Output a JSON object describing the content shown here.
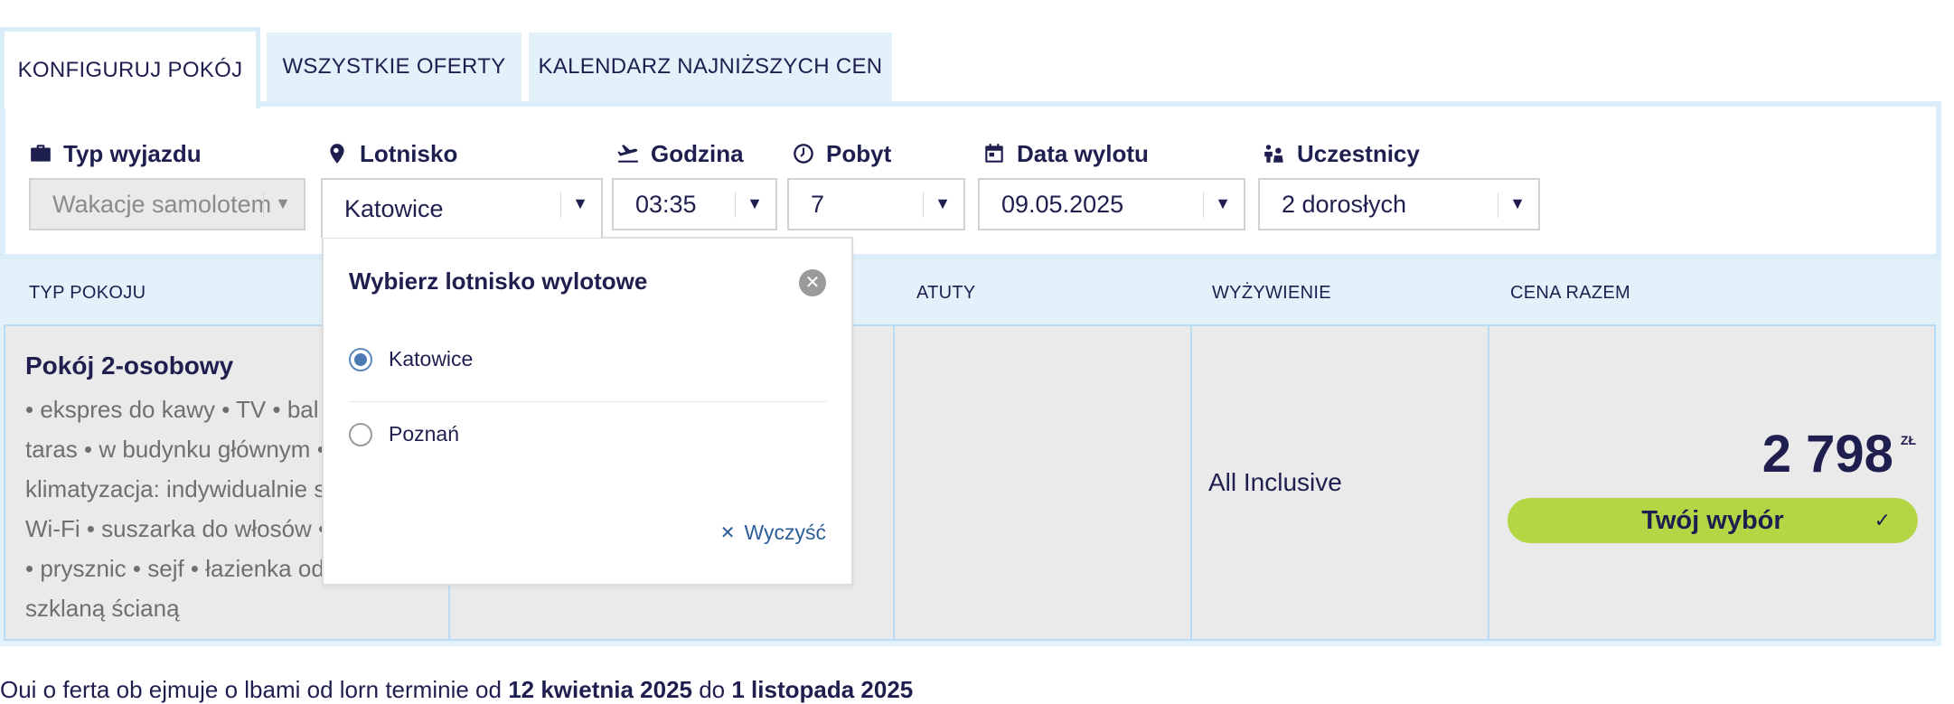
{
  "tabs": [
    {
      "label": "KONFIGURUJ POKÓJ",
      "active": true
    },
    {
      "label": "WSZYSTKIE OFERTY",
      "active": false
    },
    {
      "label": "KALENDARZ NAJNIŻSZYCH CEN",
      "active": false
    }
  ],
  "config": {
    "trip_type": {
      "label": "Typ wyjazdu",
      "value": "Wakacje samolotem",
      "icon": "briefcase-icon"
    },
    "airport": {
      "label": "Lotnisko",
      "value": "Katowice",
      "icon": "map-pin-icon"
    },
    "time": {
      "label": "Godzina",
      "value": "03:35",
      "icon": "plane-departure-icon"
    },
    "stay": {
      "label": "Pobyt",
      "value": "7",
      "icon": "clock-icon"
    },
    "date": {
      "label": "Data wylotu",
      "value": "09.05.2025",
      "icon": "calendar-icon"
    },
    "participants": {
      "label": "Uczestnicy",
      "value": "2 dorosłych",
      "icon": "people-icon"
    }
  },
  "table": {
    "headers": [
      "TYP POKOJU",
      "ATUTY",
      "WYŻYWIENIE",
      "CENA RAZEM"
    ],
    "row": {
      "room_title": "Pokój 2-osobowy",
      "room_desc_lines": [
        "• ekspres do kawy • TV • bal",
        "taras • w budynku głównym •",
        "klimatyzacja: indywidualnie st",
        "Wi-Fi • suszarka do włosów •",
        "• prysznic • sejf • łazienka od",
        "szklaną ścianą"
      ],
      "meal": "All Inclusive",
      "price": "2 798",
      "currency": "ZŁ",
      "choice_label": "Twój wybór",
      "choice_icon": "check-icon"
    }
  },
  "popup": {
    "title": "Wybierz lotnisko wylotowe",
    "options": [
      {
        "label": "Katowice",
        "selected": true
      },
      {
        "label": "Poznań",
        "selected": false
      }
    ],
    "clear_label": "Wyczyść"
  },
  "note": {
    "prefix": "Oui o ferta ob ejmuje o lbami od lorn terminie od ",
    "date_from": "12 kwietnia 2025",
    "mid": " do ",
    "date_to": "1 listopada 2025"
  },
  "colors": {
    "navy": "#1f1f4f",
    "light_blue": "#e3f1fb",
    "accent_green": "#b4d645",
    "link_blue": "#2c5f99"
  }
}
